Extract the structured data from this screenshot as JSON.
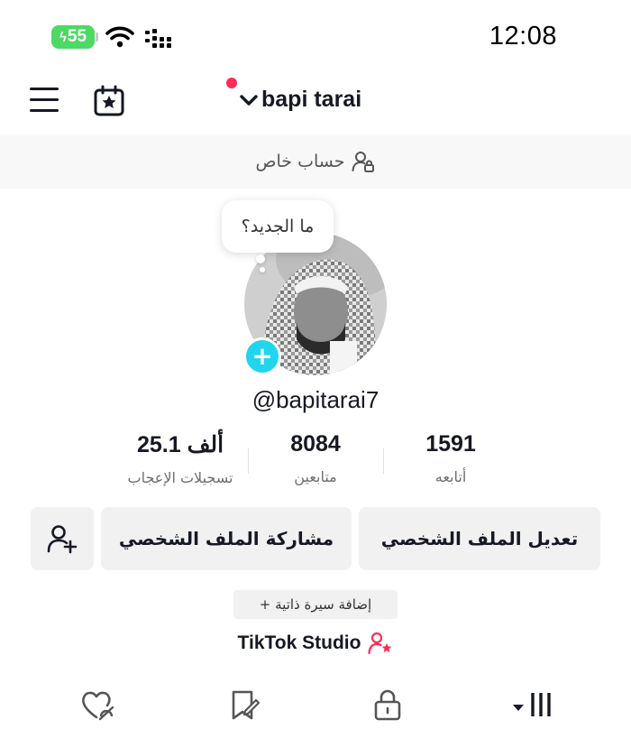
{
  "status_bar": {
    "battery_level": "55",
    "time": "12:08"
  },
  "header": {
    "username": "bapi tarai"
  },
  "private_banner": {
    "label": "حساب خاص"
  },
  "profile": {
    "bubble_text": "ما الجديد؟",
    "handle": "@bapitarai7"
  },
  "stats": {
    "following": {
      "value": "1591",
      "label": "أتابعه"
    },
    "followers": {
      "value": "8084",
      "label": "متابعين"
    },
    "likes": {
      "value": "25.1 ألف",
      "label": "تسجيلات الإعجاب"
    }
  },
  "actions": {
    "edit_profile": "تعديل الملف الشخصي",
    "share_profile": "مشاركة الملف الشخصي"
  },
  "bio": {
    "add_label": "+ إضافة سيرة ذاتية"
  },
  "studio": {
    "label": "TikTok Studio"
  },
  "colors": {
    "accent": "#fe2c55",
    "add_button": "#20d5ec",
    "battery": "#4cd964"
  },
  "icons": [
    "menu-icon",
    "calendar-star-icon",
    "chevron-down-icon",
    "lock-user-icon",
    "plus-icon",
    "add-friend-icon",
    "user-star-icon",
    "grid-icon",
    "lock-icon",
    "bookmark-icon",
    "heart-icon"
  ]
}
